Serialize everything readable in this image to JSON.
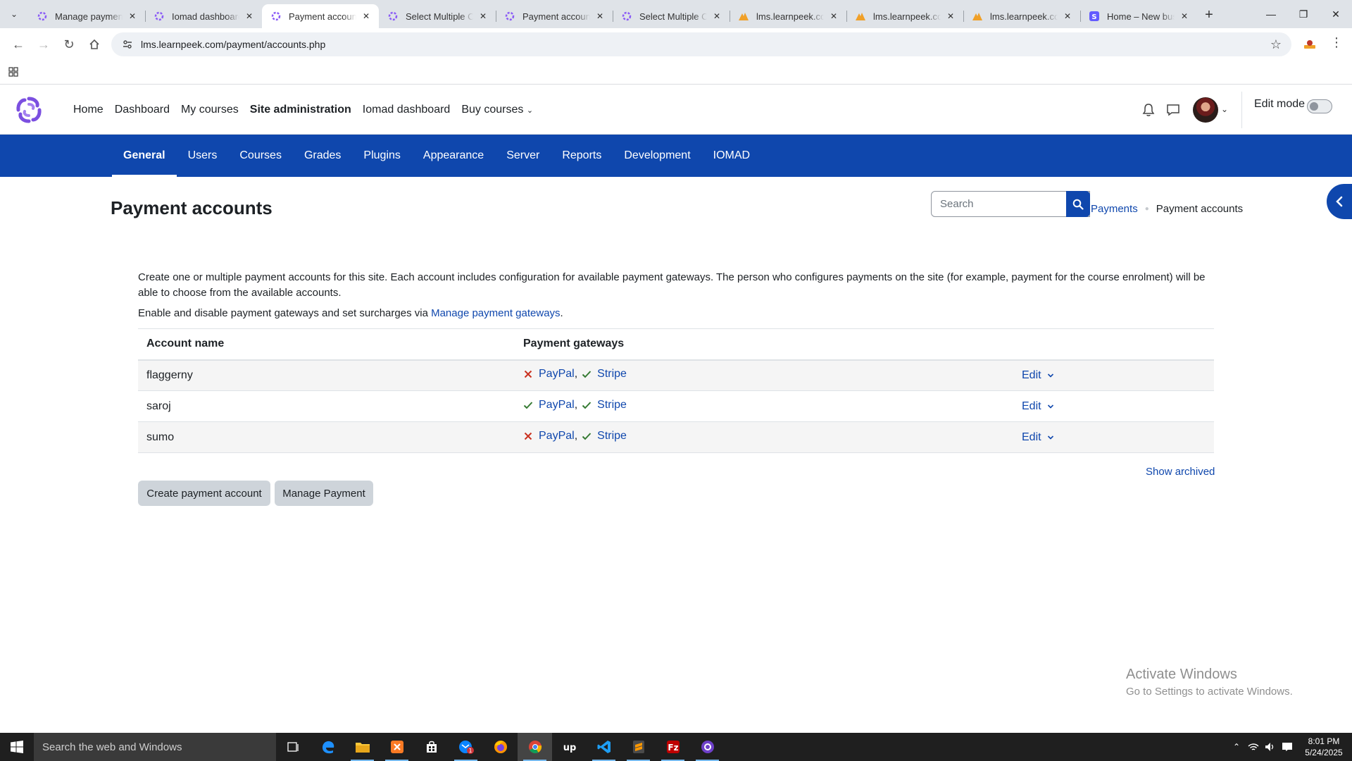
{
  "browser": {
    "tabs": [
      {
        "title": "Manage payment",
        "icon": "moodle-favicon-icon"
      },
      {
        "title": "Iomad dashboard",
        "icon": "moodle-favicon-icon"
      },
      {
        "title": "Payment accounts",
        "icon": "moodle-favicon-icon",
        "active": true
      },
      {
        "title": "Select Multiple Co",
        "icon": "moodle-favicon-icon"
      },
      {
        "title": "Payment accounts",
        "icon": "moodle-favicon-icon"
      },
      {
        "title": "Select Multiple Co",
        "icon": "moodle-favicon-icon"
      },
      {
        "title": "lms.learnpeek.com",
        "icon": "cpanel-favicon-icon"
      },
      {
        "title": "lms.learnpeek.com",
        "icon": "cpanel-favicon-icon"
      },
      {
        "title": "lms.learnpeek.com",
        "icon": "cpanel-favicon-icon"
      },
      {
        "title": "Home – New busi",
        "icon": "stripe-favicon-icon"
      }
    ],
    "url": "lms.learnpeek.com/payment/accounts.php"
  },
  "header": {
    "nav": [
      "Home",
      "Dashboard",
      "My courses",
      "Site administration",
      "Iomad dashboard",
      "Buy courses"
    ],
    "edit_mode_label": "Edit mode"
  },
  "secondary_nav": [
    "General",
    "Users",
    "Courses",
    "Grades",
    "Plugins",
    "Appearance",
    "Server",
    "Reports",
    "Development",
    "IOMAD"
  ],
  "page": {
    "title": "Payment accounts",
    "search_placeholder": "Search",
    "breadcrumb": {
      "parent": "Payments",
      "current": "Payment accounts"
    },
    "intro": "Create one or multiple payment accounts for this site. Each account includes configuration for available payment gateways. The person who configures payments on the site (for example, payment for the course enrolment) will be able to choose from the available accounts.",
    "gateways_text": "Enable and disable payment gateways and set surcharges via ",
    "gateways_link": "Manage payment gateways",
    "gateways_suffix": "."
  },
  "table": {
    "headers": {
      "name": "Account name",
      "gateways": "Payment gateways"
    },
    "rows": [
      {
        "name": "flaggerny",
        "paypal": "PayPal",
        "paypal_enabled": false,
        "stripe": "Stripe",
        "stripe_enabled": true,
        "action": "Edit"
      },
      {
        "name": "saroj",
        "paypal": "PayPal",
        "paypal_enabled": true,
        "stripe": "Stripe",
        "stripe_enabled": true,
        "action": "Edit"
      },
      {
        "name": "sumo",
        "paypal": "PayPal",
        "paypal_enabled": false,
        "stripe": "Stripe",
        "stripe_enabled": true,
        "action": "Edit"
      }
    ]
  },
  "actions": {
    "show_archived": "Show archived",
    "create": "Create payment account",
    "manage": "Manage Payment"
  },
  "watermark": {
    "title": "Activate Windows",
    "subtitle": "Go to Settings to activate Windows."
  },
  "taskbar": {
    "search_placeholder": "Search the web and Windows",
    "time": "8:01 PM",
    "date": "5/24/2025",
    "mail_badge": "1"
  },
  "colors": {
    "brand": "#0f47ad",
    "enabled": "#357a32",
    "disabled": "#ca3120"
  }
}
